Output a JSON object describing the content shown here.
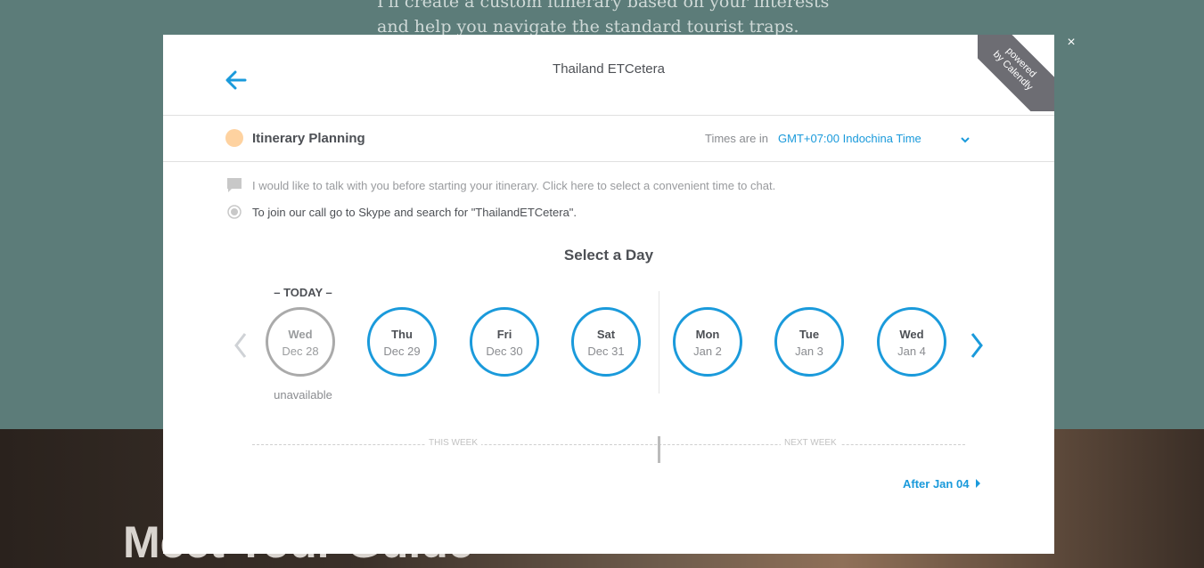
{
  "background": {
    "paragraph": "I'll create a custom itinerary based on your interests and help you navigate the standard tourist traps. Along the way you'll",
    "heading": "Meet Your Guide"
  },
  "modal": {
    "close_label": "×",
    "title": "Thailand ETCetera",
    "ribbon_line1": "powered",
    "ribbon_line2": "by Calendly",
    "event": {
      "name": "Itinerary Planning",
      "color": "#fed2a0"
    },
    "timezone": {
      "label": "Times are in",
      "value": "GMT+07:00 Indochina Time"
    },
    "details": {
      "description": "I would like to talk with you before starting your itinerary. Click here to select a convenient time to chat.",
      "location": "To join our call go to Skype and search for \"ThailandETCetera\"."
    },
    "calendar": {
      "heading": "Select a Day",
      "today_label": "– TODAY –",
      "unavailable_label": "unavailable",
      "days": [
        {
          "weekday": "Wed",
          "date": "Dec 28",
          "available": false
        },
        {
          "weekday": "Thu",
          "date": "Dec 29",
          "available": true
        },
        {
          "weekday": "Fri",
          "date": "Dec 30",
          "available": true
        },
        {
          "weekday": "Sat",
          "date": "Dec 31",
          "available": true
        },
        {
          "weekday": "Mon",
          "date": "Jan 2",
          "available": true
        },
        {
          "weekday": "Tue",
          "date": "Jan 3",
          "available": true
        },
        {
          "weekday": "Wed",
          "date": "Jan 4",
          "available": true
        }
      ],
      "this_week": "THIS WEEK",
      "next_week": "NEXT WEEK",
      "after_link": "After Jan 04"
    },
    "colors": {
      "accent": "#1a9adb",
      "text": "#4d5055",
      "muted": "#8a8c90"
    }
  }
}
